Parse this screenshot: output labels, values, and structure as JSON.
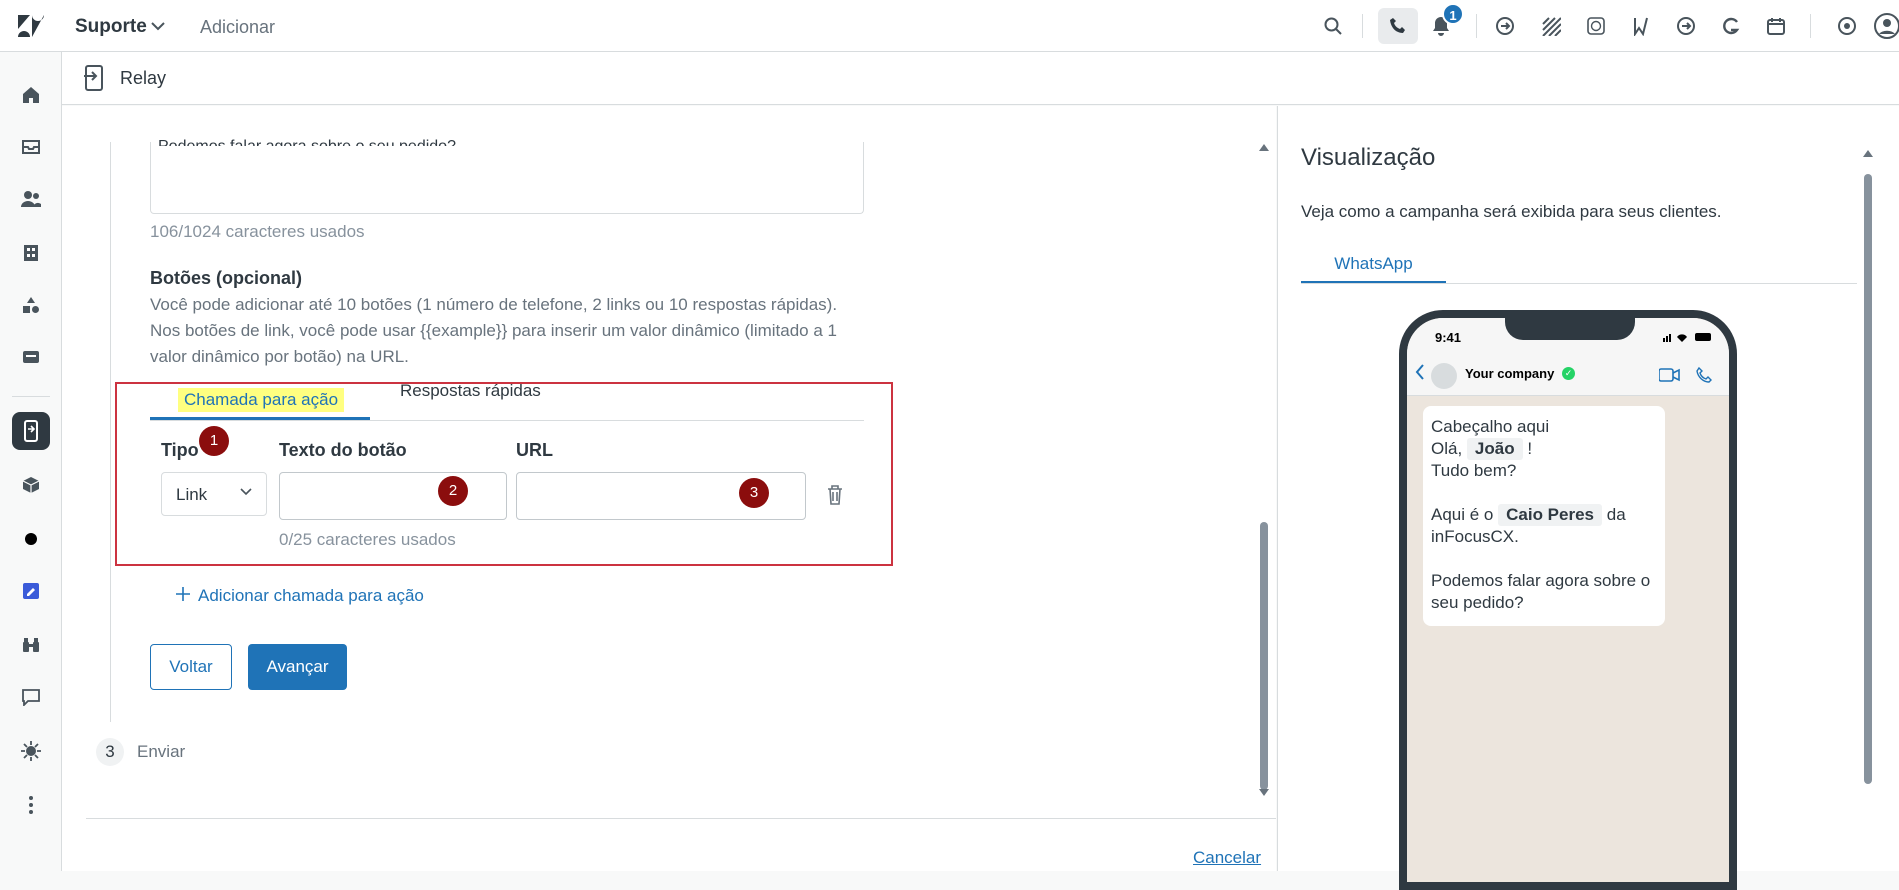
{
  "topbar": {
    "product": "Suporte",
    "add_label": "Adicionar",
    "notification_count": "1"
  },
  "header": {
    "title": "Relay"
  },
  "form": {
    "textarea_cut_text": "Podemos falar agora sobre o seu pedido?",
    "char_counter": "106/1024 caracteres usados",
    "buttons_title": "Botões (opcional)",
    "buttons_description": "Você pode adicionar até 10 botões (1 número de telefone, 2 links ou 10 respostas rápidas). Nos botões de link, você pode usar {{example}} para inserir um valor dinâmico (limitado a 1 valor dinâmico por botão) na URL.",
    "tabs": {
      "cta": "Chamada para ação",
      "quick_replies": "Respostas rápidas"
    },
    "columns": {
      "type": "Tipo",
      "button_text": "Texto do botão",
      "url": "URL"
    },
    "type_value": "Link",
    "button_text_value": "",
    "url_value": "",
    "button_char_counter": "0/25 caracteres usados",
    "markers": [
      "1",
      "2",
      "3"
    ],
    "add_cta": "Adicionar chamada para ação",
    "back": "Voltar",
    "next": "Avançar",
    "step3_number": "3",
    "step3_label": "Enviar",
    "cancel": "Cancelar"
  },
  "preview": {
    "title": "Visualização",
    "description": "Veja como a campanha será exibida para seus clientes.",
    "tab": "WhatsApp",
    "phone": {
      "time": "9:41",
      "contact": "Your company",
      "msg_header": "Cabeçalho aqui",
      "greeting_prefix": "Olá,",
      "customer_name": "João",
      "greeting_suffix": "!",
      "line2": "Tudo bem?",
      "agent_prefix": "Aqui é o",
      "agent_name": "Caio Peres",
      "agent_suffix": "da",
      "company": "inFocusCX.",
      "question": "Podemos falar agora sobre o seu pedido?"
    }
  },
  "colors": {
    "accent": "#1f73b7",
    "highlight_box": "#cc3340",
    "marker": "#8b0d0d",
    "tab_highlight": "#ffff80"
  }
}
